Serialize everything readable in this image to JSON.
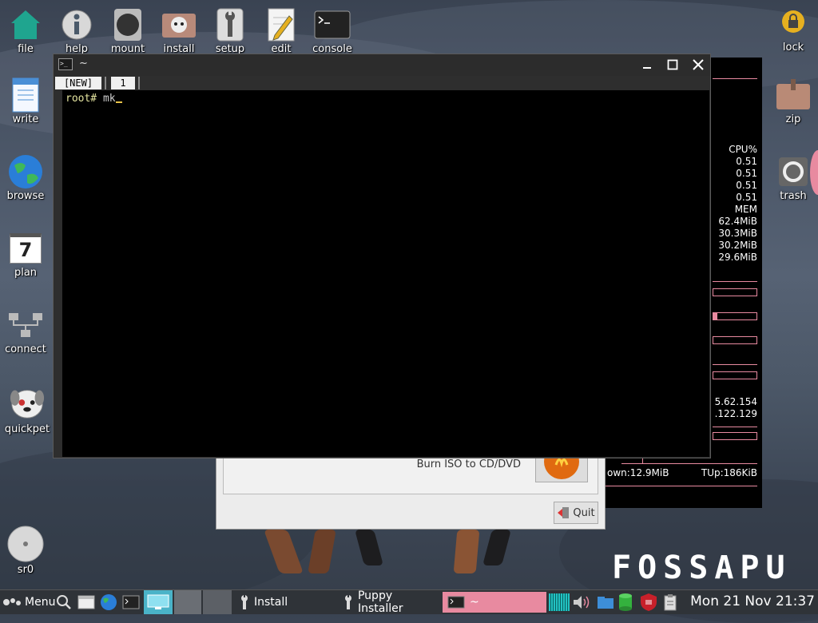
{
  "desktop_icons": {
    "file": "file",
    "help": "help",
    "mount": "mount",
    "install": "install",
    "setup": "setup",
    "edit": "edit",
    "console": "console",
    "write": "write",
    "browse": "browse",
    "plan": "plan",
    "plan_day": "7",
    "connect": "connect",
    "quickpet": "quickpet",
    "sr0": "sr0",
    "lock": "lock",
    "zip": "zip",
    "trash": "trash"
  },
  "conky": {
    "cpu_header": "CPU%",
    "cpu": [
      "0.51",
      "0.51",
      "0.51",
      "0.51"
    ],
    "mem_header": "MEM",
    "mem": [
      "62.4MiB",
      "30.3MiB",
      "30.2MiB",
      "29.6MiB"
    ],
    "ips": [
      "5.62.154",
      ".122.129"
    ],
    "down": "own:12.9MiB",
    "up": "TUp:186KiB"
  },
  "installer": {
    "burn_label": "Burn ISO to CD/DVD",
    "quit_label": "Quit"
  },
  "terminal": {
    "title": "~",
    "tabs": [
      "[NEW]",
      "1"
    ],
    "prompt": "root# ",
    "command": "mk"
  },
  "brand": "FOSSAPU",
  "taskbar": {
    "menu_label": "Menu",
    "tasks": [
      "Install",
      "Puppy Installer",
      "~"
    ],
    "clock": "Mon 21 Nov 21:37"
  },
  "colors": {
    "accent_pink": "#e88aa0",
    "terminal_bg": "#000000",
    "prompt_yellow": "#e5e5a0"
  }
}
